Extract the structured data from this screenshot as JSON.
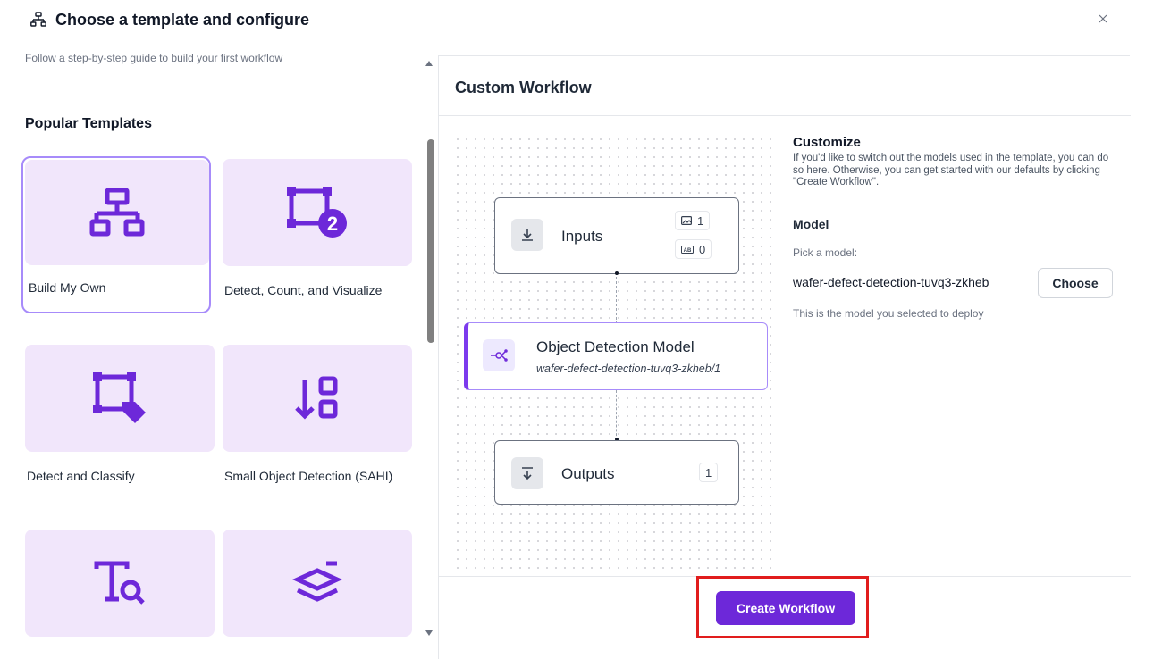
{
  "header": {
    "title": "Choose a template and configure"
  },
  "left": {
    "hint": "Follow a step-by-step guide to build your first workflow",
    "section_title": "Popular Templates",
    "templates": [
      {
        "label": "Build My Own",
        "icon": "hierarchy-icon",
        "selected": true
      },
      {
        "label": "Detect, Count, and Visualize",
        "icon": "count-bbox-icon",
        "selected": false
      },
      {
        "label": "Detect and Classify",
        "icon": "bbox-tag-icon",
        "selected": false
      },
      {
        "label": "Small Object Detection (SAHI)",
        "icon": "sort-boxes-icon",
        "selected": false
      },
      {
        "label": "",
        "icon": "text-search-icon",
        "selected": false
      },
      {
        "label": "",
        "icon": "layers-icon",
        "selected": false
      }
    ]
  },
  "right": {
    "title": "Custom Workflow",
    "nodes": {
      "inputs": {
        "label": "Inputs",
        "image_count": "1",
        "text_count": "0"
      },
      "model": {
        "label": "Object Detection Model",
        "sub": "wafer-defect-detection-tuvq3-zkheb/1"
      },
      "outputs": {
        "label": "Outputs",
        "count": "1"
      }
    },
    "customize": {
      "title": "Customize",
      "description": "If you'd like to switch out the models used in the template, you can do so here. Otherwise, you can get started with our defaults by clicking \"Create Workflow\".",
      "model_title": "Model",
      "pick_label": "Pick a model:",
      "model_value": "wafer-defect-detection-tuvq3-zkheb",
      "choose_label": "Choose",
      "model_note": "This is the model you selected to deploy"
    },
    "create_label": "Create Workflow"
  },
  "colors": {
    "accent": "#6d28d9",
    "tile_bg": "#f1e6fb",
    "highlight": "#e11d1d"
  }
}
